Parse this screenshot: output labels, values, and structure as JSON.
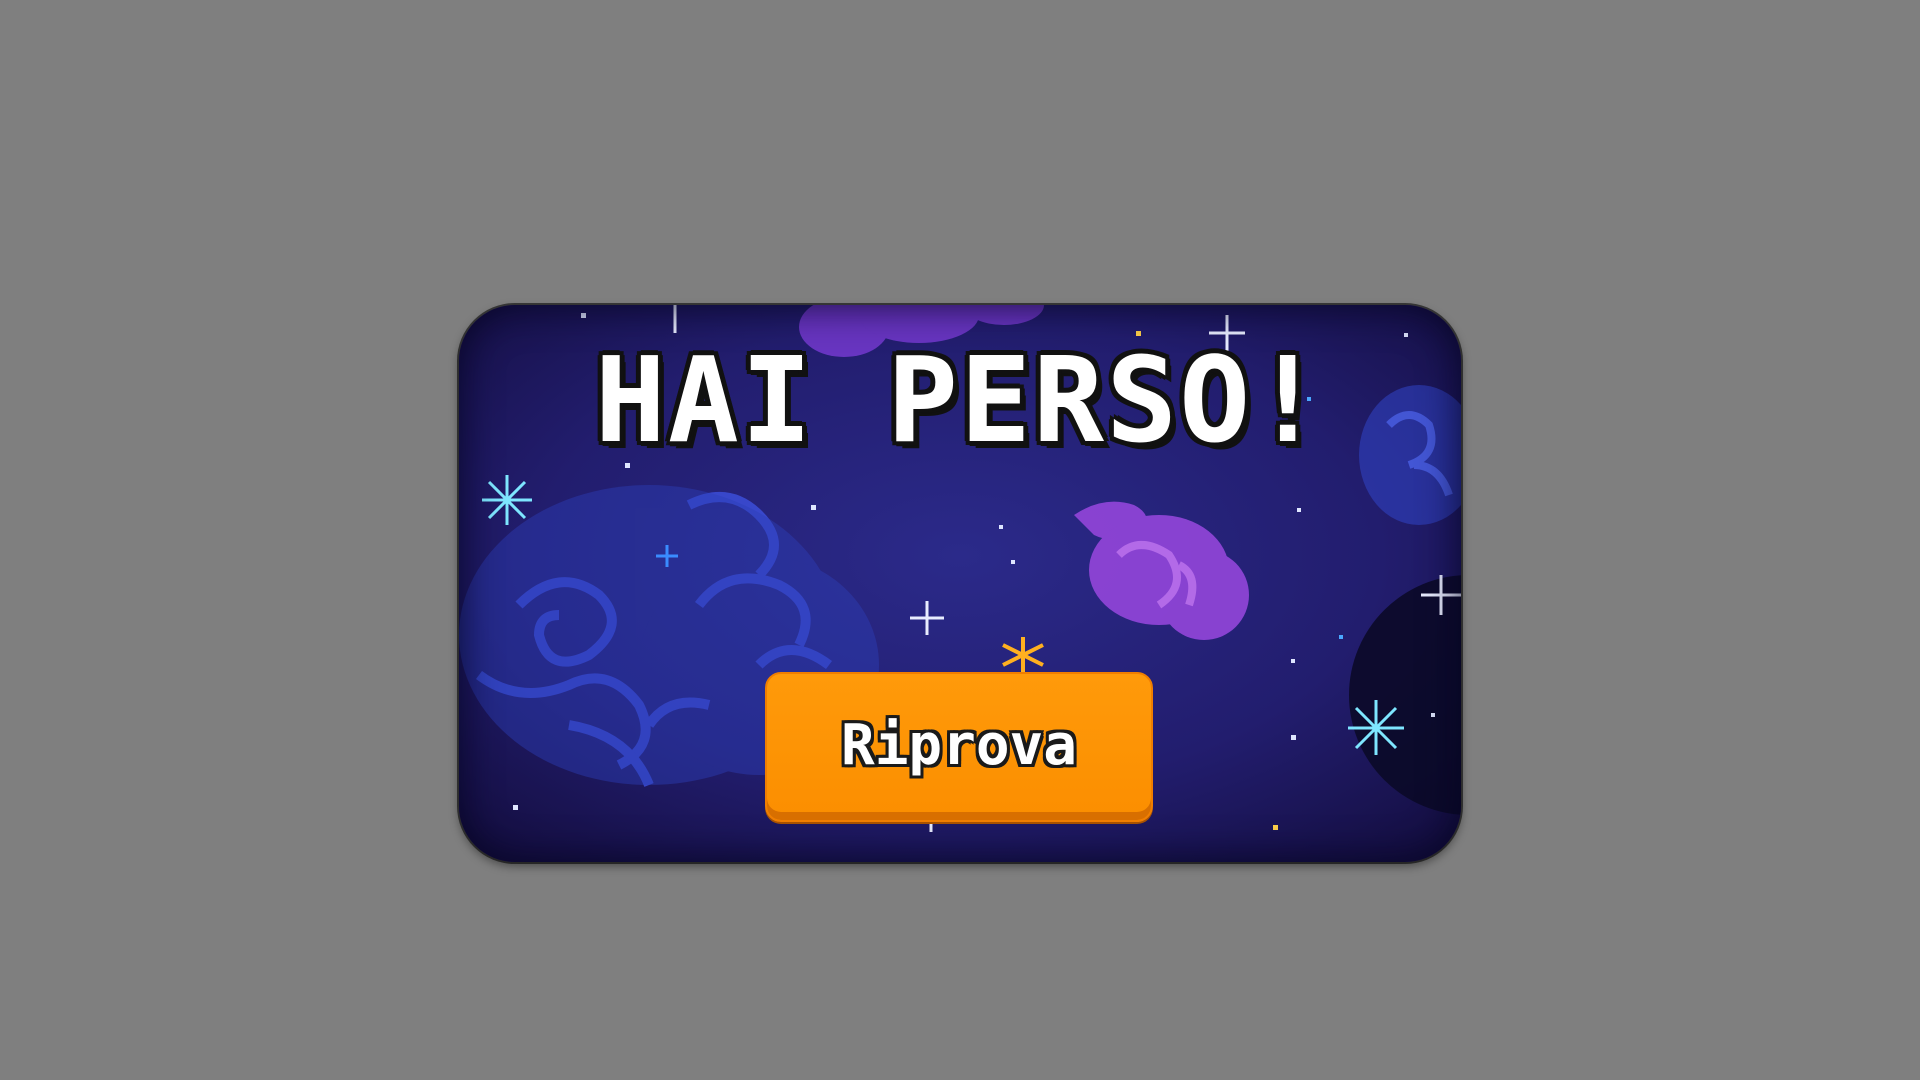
{
  "game_over": {
    "title": "HAI PERSO!",
    "retry_label": "Riprova"
  },
  "colors": {
    "page_background": "#7f7f7f",
    "panel_background": "#1e1a5c",
    "button_orange": "#fb8e00",
    "title_text": "#ffffff"
  },
  "icons": {
    "background": "pixel-space-nebula",
    "stars": "sparkle-star-icon"
  }
}
